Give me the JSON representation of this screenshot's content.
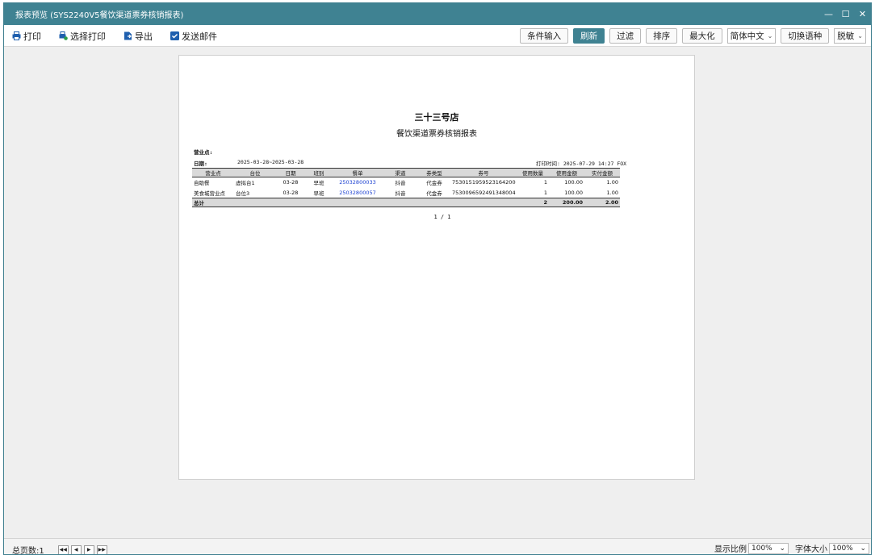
{
  "window": {
    "title": "报表预览 (SYS2240V5餐饮渠道票券核销报表)",
    "controls": [
      "—",
      "☐",
      "✕"
    ]
  },
  "toolbar": {
    "print": "打印",
    "select_print": "选择打印",
    "export": "导出",
    "send_mail": "发送邮件",
    "condition_input": "条件输入",
    "refresh": "刷新",
    "filter": "过滤",
    "sort": "排序",
    "maximize": "最大化",
    "language": "简体中文",
    "switch_lang": "切换语种",
    "sensitive": "脱敏"
  },
  "report": {
    "store": "三十三号店",
    "title": "餐饮渠道票券核销报表",
    "outlet_label": "营业点:",
    "date_label": "日期:",
    "date_value": "2025-03-28~2025-03-28",
    "print_time": "打印时间: 2025-07-29 14:27 FOX",
    "headers": [
      "营业点",
      "台位",
      "日期",
      "班别",
      "餐单",
      "渠道",
      "券类型",
      "券号",
      "使用数量",
      "使用金额",
      "实付金额"
    ],
    "rows": [
      [
        "自助餐",
        "虚拟台1",
        "03-28",
        "早班",
        "25032800033",
        "抖音",
        "代金券",
        "7530151959523164200",
        "1",
        "100.00",
        "1.00"
      ],
      [
        "美食城营业点",
        "台位3",
        "03-28",
        "早班",
        "25032800057",
        "抖音",
        "代金券",
        "7530096592491348004",
        "1",
        "100.00",
        "1.00"
      ]
    ],
    "total": {
      "label": "总计",
      "count": "2",
      "amount": "200.00",
      "paid": "2.00"
    },
    "page": "1 / 1"
  },
  "status": {
    "total_pages": "总页数:1",
    "zoom_label": "显示比例",
    "zoom_value": "100%",
    "font_label": "字体大小",
    "font_value": "100%"
  }
}
